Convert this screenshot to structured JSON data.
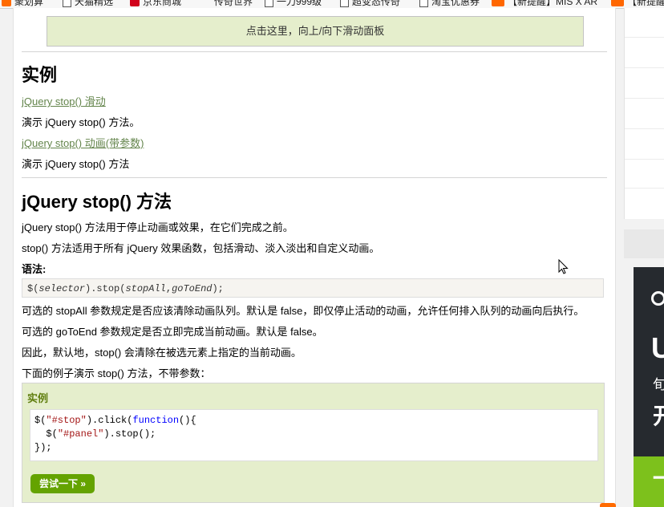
{
  "bookmarks": [
    {
      "label": "聚划算",
      "icon": "orange-logo-icon"
    },
    {
      "label": "天猫精选",
      "icon": "page-icon"
    },
    {
      "label": "京东商城",
      "icon": "jd-icon"
    },
    {
      "label": "传奇世界",
      "icon": "none"
    },
    {
      "label": "一刀999级",
      "icon": "page-icon"
    },
    {
      "label": "超变态传奇",
      "icon": "page-icon"
    },
    {
      "label": "淘宝优惠券",
      "icon": "page-icon"
    },
    {
      "label": "【新提醒】MIS X AR",
      "icon": "mi-icon"
    },
    {
      "label": "【新提醒",
      "icon": "mi-icon"
    }
  ],
  "flip_panel": {
    "label": "点击这里，向上/向下滑动面板"
  },
  "examples_section": {
    "heading": "实例",
    "items": [
      {
        "link": "jQuery stop() 滑动",
        "desc": "演示 jQuery stop() 方法。"
      },
      {
        "link": "jQuery stop() 动画(带参数)",
        "desc": "演示 jQuery stop() 方法"
      }
    ]
  },
  "method_section": {
    "heading": "jQuery stop() 方法",
    "p1": "jQuery stop() 方法用于停止动画或效果，在它们完成之前。",
    "p2": "stop() 方法适用于所有 jQuery 效果函数，包括滑动、淡入淡出和自定义动画。",
    "syntax_label": "语法:",
    "syntax": {
      "pre": "$(",
      "arg1": "selector",
      "mid": ").stop(",
      "arg2": "stopAll",
      "comma": ",",
      "arg3": "goToEnd",
      "post": ");"
    },
    "p3": "可选的 stopAll 参数规定是否应该清除动画队列。默认是 false，即仅停止活动的动画，允许任何排入队列的动画向后执行。",
    "p4": "可选的 goToEnd 参数规定是否立即完成当前动画。默认是 false。",
    "p5": "因此，默认地，stop() 会清除在被选元素上指定的当前动画。",
    "p6": "下面的例子演示 stop() 方法，不带参数："
  },
  "example_box": {
    "title": "实例",
    "code": {
      "l1_a": "$(",
      "l1_b": "\"#stop\"",
      "l1_c": ").click(",
      "l1_d": "function",
      "l1_e": "(){",
      "l2_a": "  $(",
      "l2_b": "\"#panel\"",
      "l2_c": ").stop();",
      "l3": "});"
    },
    "try_button": "尝试一下 »"
  },
  "ad": {
    "big": "U",
    "small": "旬",
    "med": "开",
    "green": "一"
  },
  "colors": {
    "panel_bg": "#e5eecc",
    "link": "#64854c",
    "button": "#64a300",
    "example_title": "#617f10"
  }
}
